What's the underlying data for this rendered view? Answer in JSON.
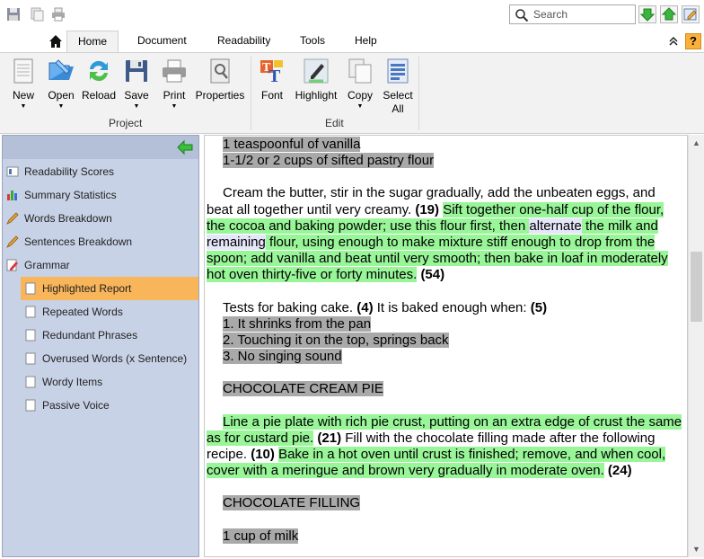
{
  "toolbar": {
    "search_placeholder": "Search"
  },
  "tabs": [
    {
      "label": "Home"
    },
    {
      "label": "Document"
    },
    {
      "label": "Readability"
    },
    {
      "label": "Tools"
    },
    {
      "label": "Help"
    }
  ],
  "help_button": "?",
  "ribbon": {
    "project": {
      "group_label": "Project",
      "buttons": [
        {
          "label": "New",
          "icon": "new-document-icon"
        },
        {
          "label": "Open",
          "icon": "open-folder-icon"
        },
        {
          "label": "Reload",
          "icon": "reload-icon"
        },
        {
          "label": "Save",
          "icon": "save-floppy-icon"
        },
        {
          "label": "Print",
          "icon": "printer-icon"
        },
        {
          "label": "Properties",
          "icon": "properties-icon"
        }
      ]
    },
    "edit": {
      "group_label": "Edit",
      "buttons": [
        {
          "label": "Font",
          "icon": "font-icon"
        },
        {
          "label": "Highlight",
          "icon": "highlight-pen-icon"
        },
        {
          "label": "Copy",
          "icon": "copy-icon"
        },
        {
          "label": "Select",
          "label2": "All",
          "icon": "select-all-icon"
        }
      ]
    }
  },
  "sidebar": {
    "items": [
      {
        "label": "Readability Scores",
        "icon": "readability-scores-icon"
      },
      {
        "label": "Summary Statistics",
        "icon": "bar-chart-icon"
      },
      {
        "label": "Words Breakdown",
        "icon": "pencil-icon"
      },
      {
        "label": "Sentences Breakdown",
        "icon": "pencil-icon"
      },
      {
        "label": "Grammar",
        "icon": "grammar-icon"
      },
      {
        "label": "Highlighted Report",
        "icon": "page-icon",
        "selected": true
      },
      {
        "label": "Repeated Words",
        "icon": "page-icon"
      },
      {
        "label": "Redundant Phrases",
        "icon": "page-icon"
      },
      {
        "label": "Overused Words (x Sentence)",
        "icon": "page-icon"
      },
      {
        "label": "Wordy Items",
        "icon": "page-icon"
      },
      {
        "label": "Passive Voice",
        "icon": "page-icon"
      }
    ]
  },
  "document": {
    "l1": "1 teaspoonful of vanilla",
    "l2": "1-1/2 or 2 cups of sifted pastry flour",
    "p1_a": "Cream the butter, stir in the sugar gradually, add the unbeaten eggs, and beat all together until very creamy.",
    "p1_n1": "(19)",
    "p1_b": "Sift together one-half cup of the flour, the cocoa and baking powder; use this flour first, then",
    "p1_w1": "alternate",
    "p1_c": "the milk and",
    "p1_w2": "remaining",
    "p1_d": "flour, using enough to make mixture stiff enough to drop from the spoon; add vanilla and beat until very smooth; then bake in loaf in moderately hot oven thirty-five or forty minutes.",
    "p1_n2": "(54)",
    "p2_a": "Tests for baking cake.",
    "p2_n1": "(4)",
    "p2_b": "It is baked enough when:",
    "p2_n2": "(5)",
    "li1": "1. It shrinks from the pan",
    "li2": "2. Touching it on the top, springs back",
    "li3": "3. No singing sound",
    "h1": "CHOCOLATE CREAM PIE",
    "p3_a": "Line a pie plate with rich pie crust, putting on an extra edge of crust the same as for custard pie.",
    "p3_n1": "(21)",
    "p3_b": "Fill with the chocolate filling made after the following recipe.",
    "p3_n2": "(10)",
    "p3_c": "Bake in a hot oven until crust is finished; remove, and when cool, cover with a meringue and brown very gradually in moderate oven.",
    "p3_n3": "(24)",
    "h2": "CHOCOLATE FILLING",
    "l3": "1 cup of milk"
  },
  "colors": {
    "sidebar_bg": "#c8d2e6",
    "selected": "#f9b55a",
    "highlight_green": "#98f598",
    "highlight_gray": "#a9a9a9"
  }
}
